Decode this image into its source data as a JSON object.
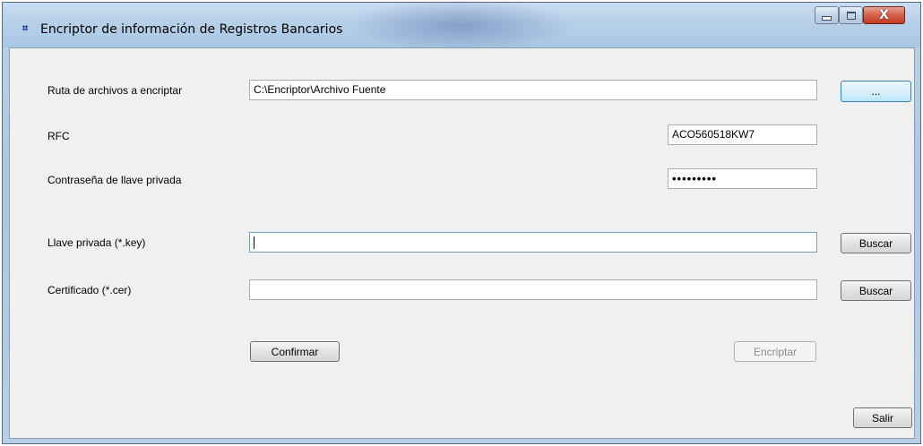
{
  "window": {
    "title": "Encriptor de información de Registros Bancarios",
    "icon": "app-icon",
    "controls": {
      "minimize": "minimize-icon",
      "maximize": "maximize-icon",
      "close_glyph": "X"
    }
  },
  "form": {
    "ruta": {
      "label": "Ruta de archivos a encriptar",
      "value": "C:\\Encriptor\\Archivo Fuente",
      "browse_label": "..."
    },
    "rfc": {
      "label": "RFC",
      "value": "ACO560518KW7"
    },
    "password": {
      "label": "Contraseña de llave privada",
      "value": "•••••••••"
    },
    "llave": {
      "label": "Llave privada (*.key)",
      "value": "",
      "browse_label": "Buscar"
    },
    "certificado": {
      "label": "Certificado (*.cer)",
      "value": "",
      "browse_label": "Buscar"
    }
  },
  "actions": {
    "confirmar": "Confirmar",
    "encriptar": "Encriptar",
    "salir": "Salir"
  }
}
